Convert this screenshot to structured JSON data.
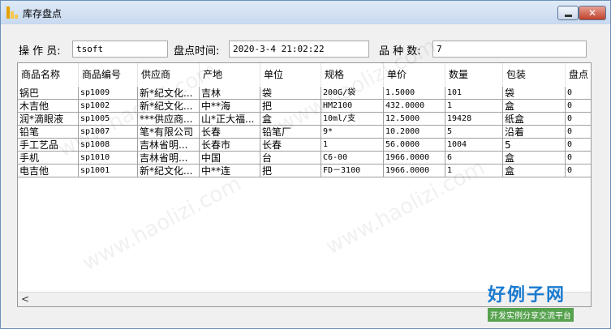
{
  "window": {
    "title": "库存盘点"
  },
  "form": {
    "operator_label": "操 作 员:",
    "operator_value": "tsoft",
    "time_label": "盘点时间:",
    "time_value": "2020-3-4 21:02:22",
    "kinds_label": "品 种 数:",
    "kinds_value": "7"
  },
  "table": {
    "columns": [
      "商品名称",
      "商品编号",
      "供应商",
      "产地",
      "单位",
      "规格",
      "单价",
      "数量",
      "包装",
      "盘点"
    ],
    "rows": [
      [
        "锅巴",
        "sp1009",
        "新*纪文化...",
        "吉林",
        "袋",
        "200G/袋",
        "1.5000",
        "101",
        "袋",
        "0"
      ],
      [
        "木吉他",
        "sp1002",
        "新*纪文化...",
        "中**海",
        "把",
        "HM2100",
        "432.0000",
        "1",
        "盒",
        "0"
      ],
      [
        "润*滴眼液",
        "sp1005",
        "***供应商...",
        "山*正大福...",
        "盒",
        "10ml/支",
        "12.5000",
        "19428",
        "纸盒",
        "0"
      ],
      [
        "铅笔",
        "sp1007",
        "笔*有限公司",
        "长春",
        "铅笔厂",
        "9*",
        "10.2000",
        "5",
        "沿着",
        "0"
      ],
      [
        "手工艺品",
        "sp1008",
        "吉林省明...",
        "长春市",
        "长春",
        "1",
        "56.0000",
        "1004",
        "5",
        "0"
      ],
      [
        "手机",
        "sp1010",
        "吉林省明...",
        "中国",
        "台",
        "C6-00",
        "1966.0000",
        "6",
        "盒",
        "0"
      ],
      [
        "电吉他",
        "sp1001",
        "新*纪文化...",
        "中**连",
        "把",
        "FD－3100",
        "1966.0000",
        "1",
        "盒",
        "0"
      ]
    ]
  },
  "scrollbar": {
    "left_arrow": "<"
  },
  "watermark": {
    "text": "www.haolizi.com",
    "logo_title": "好例子网",
    "logo_sub": "开发实例分享交流平台"
  },
  "colors": {
    "title_bar": "#c8d9ef",
    "close_button": "#c0412c",
    "logo_blue": "#1b7bd1",
    "logo_green": "#56a24e"
  }
}
